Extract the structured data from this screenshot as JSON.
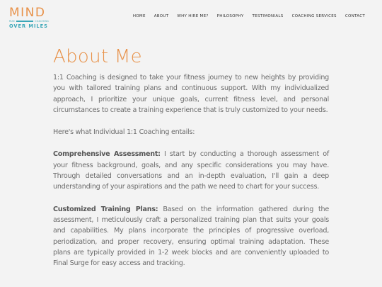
{
  "logo": {
    "top_text": "MIND",
    "left_small": "RUN",
    "right_small": "COACHING",
    "bottom_text": "OVER MILES"
  },
  "nav": {
    "items": [
      {
        "label": "HOME"
      },
      {
        "label": "ABOUT"
      },
      {
        "label": "WHY HIRE ME?"
      },
      {
        "label": "PHILOSOPHY"
      },
      {
        "label": "TESTIMONIALS"
      },
      {
        "label": "COACHING SERVICES"
      },
      {
        "label": "CONTACT"
      }
    ]
  },
  "main": {
    "title": "About Me",
    "intro": "1:1 Coaching is designed to take your fitness journey to new heights by providing you with tailored training plans and continuous support. With my individualized approach, I prioritize your unique goals, current fitness level, and personal circumstances to create a training experience that is truly customized to your needs.",
    "lead": "Here's what Individual 1:1 Coaching entails:",
    "sections": [
      {
        "heading": "Comprehensive Assessment:",
        "body": " I start by conducting a thorough assessment of your fitness background, goals, and any specific considerations you may have. Through detailed conversations and an in-depth evaluation, I'll gain a deep understanding of your aspirations and the path we need to chart for your success."
      },
      {
        "heading": "Customized Training Plans:",
        "body": " Based on the information gathered during the assessment, I meticulously craft a personalized training plan that suits your goals and capabilities. My plans incorporate the principles of progressive overload, periodization, and proper recovery, ensuring optimal training adaptation. These plans are typically provided in 1-2 week blocks and are conveniently uploaded to Final Surge for easy access and tracking."
      }
    ]
  },
  "colors": {
    "accent_orange": "#e8924a",
    "accent_teal": "#3aa7b8",
    "background": "#f3f3f3",
    "body_text": "#6b6b6b"
  }
}
